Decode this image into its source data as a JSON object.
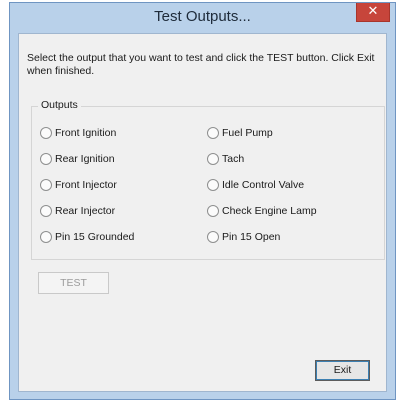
{
  "window": {
    "title": "Test Outputs...",
    "close_label": "✕"
  },
  "instructions": "Select the output that you want to test and click the TEST button. Click Exit when finished.",
  "outputs": {
    "label": "Outputs",
    "left": [
      "Front Ignition",
      "Rear Ignition",
      "Front Injector",
      "Rear Injector",
      "Pin 15 Grounded"
    ],
    "right": [
      "Fuel Pump",
      "Tach",
      "Idle Control Valve",
      "Check Engine Lamp",
      "Pin 15 Open"
    ],
    "selected": null
  },
  "buttons": {
    "test_label": "TEST",
    "test_enabled": false,
    "exit_label": "Exit"
  },
  "colors": {
    "frame": "#b9d1ea",
    "close": "#c7453b",
    "client": "#f0f0f0"
  }
}
